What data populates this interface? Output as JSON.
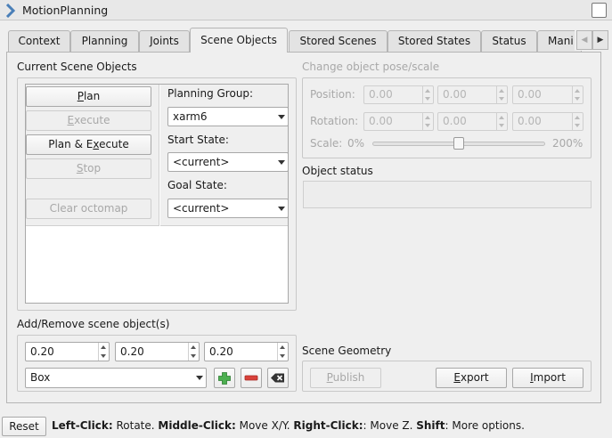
{
  "window": {
    "title": "MotionPlanning"
  },
  "tabs": [
    {
      "label": "Context"
    },
    {
      "label": "Planning"
    },
    {
      "label": "Joints"
    },
    {
      "label": "Scene Objects",
      "active": true
    },
    {
      "label": "Stored Scenes"
    },
    {
      "label": "Stored States"
    },
    {
      "label": "Status"
    },
    {
      "label": "Mani"
    }
  ],
  "scene_objects": {
    "group_label": "Current Scene Objects",
    "buttons": {
      "plan": {
        "pre": "",
        "key": "P",
        "post": "lan"
      },
      "execute": {
        "pre": "",
        "key": "E",
        "post": "xecute"
      },
      "plan_execute": {
        "pre": "Plan & E",
        "key": "x",
        "post": "ecute"
      },
      "stop": {
        "pre": "",
        "key": "S",
        "post": "top"
      },
      "clear_octomap": "Clear octomap"
    },
    "planning_group_label": "Planning Group:",
    "planning_group_value": "xarm6",
    "start_state_label": "Start State:",
    "start_state_value": "<current>",
    "goal_state_label": "Goal State:",
    "goal_state_value": "<current>"
  },
  "pose": {
    "group_label": "Change object pose/scale",
    "position_label": "Position:",
    "position": [
      "0.00",
      "0.00",
      "0.00"
    ],
    "rotation_label": "Rotation:",
    "rotation": [
      "0.00",
      "0.00",
      "0.00"
    ],
    "scale_label": "Scale:",
    "scale_min": "0%",
    "scale_max": "200%",
    "scale_value": 0.5
  },
  "object_status": {
    "label": "Object status",
    "value": ""
  },
  "add_remove": {
    "group_label": "Add/Remove scene object(s)",
    "dims": [
      "0.20",
      "0.20",
      "0.20"
    ],
    "shape": "Box"
  },
  "scene_geometry": {
    "label": "Scene Geometry",
    "publish": {
      "pre": "",
      "key": "P",
      "post": "ublish"
    },
    "export": {
      "pre": "",
      "key": "E",
      "post": "xport"
    },
    "import": {
      "pre": "",
      "key": "I",
      "post": "mport"
    }
  },
  "footer": {
    "reset_label": "Reset",
    "hints": [
      {
        "bold": "Left-Click:",
        "text": " Rotate. "
      },
      {
        "bold": "Middle-Click:",
        "text": " Move X/Y. "
      },
      {
        "bold": "Right-Click:",
        "text": ": Move Z. "
      },
      {
        "bold": "Shift",
        "text": ": More options."
      }
    ]
  },
  "colors": {
    "add": "#4caf50",
    "remove": "#d9413a",
    "clear": "#333333"
  }
}
